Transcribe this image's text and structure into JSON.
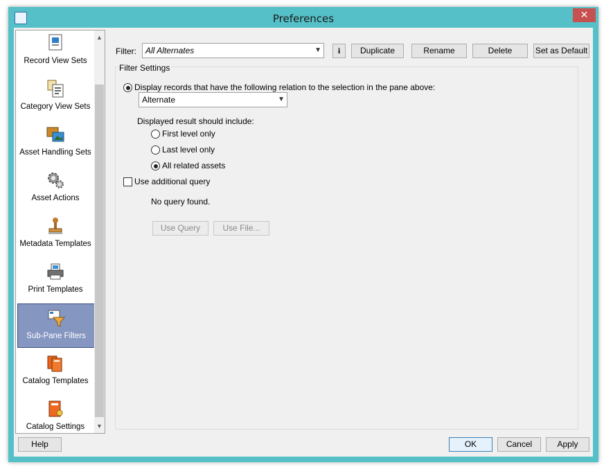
{
  "window": {
    "title": "Preferences",
    "close_glyph": "✕"
  },
  "sidebar": {
    "items": [
      {
        "label": "Record View Sets",
        "icon": "record-view-sets-icon"
      },
      {
        "label": "Category View Sets",
        "icon": "category-view-sets-icon"
      },
      {
        "label": "Asset Handling Sets",
        "icon": "asset-handling-sets-icon"
      },
      {
        "label": "Asset Actions",
        "icon": "gear-icon"
      },
      {
        "label": "Metadata Templates",
        "icon": "stamp-icon"
      },
      {
        "label": "Print Templates",
        "icon": "printer-icon"
      },
      {
        "label": "Sub-Pane Filters",
        "icon": "funnel-icon",
        "selected": true
      },
      {
        "label": "Catalog Templates",
        "icon": "catalog-templates-icon"
      },
      {
        "label": "Catalog Settings",
        "icon": "catalog-settings-icon"
      }
    ],
    "scroll_up": "▲",
    "scroll_down": "▼"
  },
  "toolbar": {
    "filter_label": "Filter:",
    "filter_value": "All Alternates",
    "info": "i",
    "duplicate": "Duplicate",
    "rename": "Rename",
    "delete": "Delete",
    "set_default": "Set as Default"
  },
  "filter_settings": {
    "title": "Filter Settings",
    "display_option": "Display records that have the following relation to the selection in the pane above:",
    "relation_value": "Alternate",
    "include_label": "Displayed result should include:",
    "include_options": [
      "First level only",
      "Last level only",
      "All related assets"
    ],
    "include_selected": 2,
    "use_query_label": "Use additional query",
    "query_status": "No query found.",
    "use_query_button": "Use Query",
    "use_file_button": "Use File..."
  },
  "footer": {
    "help": "Help",
    "ok": "OK",
    "cancel": "Cancel",
    "apply": "Apply"
  },
  "colors": {
    "frame": "#55c0c7",
    "selection": "#8596c1",
    "close": "#c75050"
  }
}
